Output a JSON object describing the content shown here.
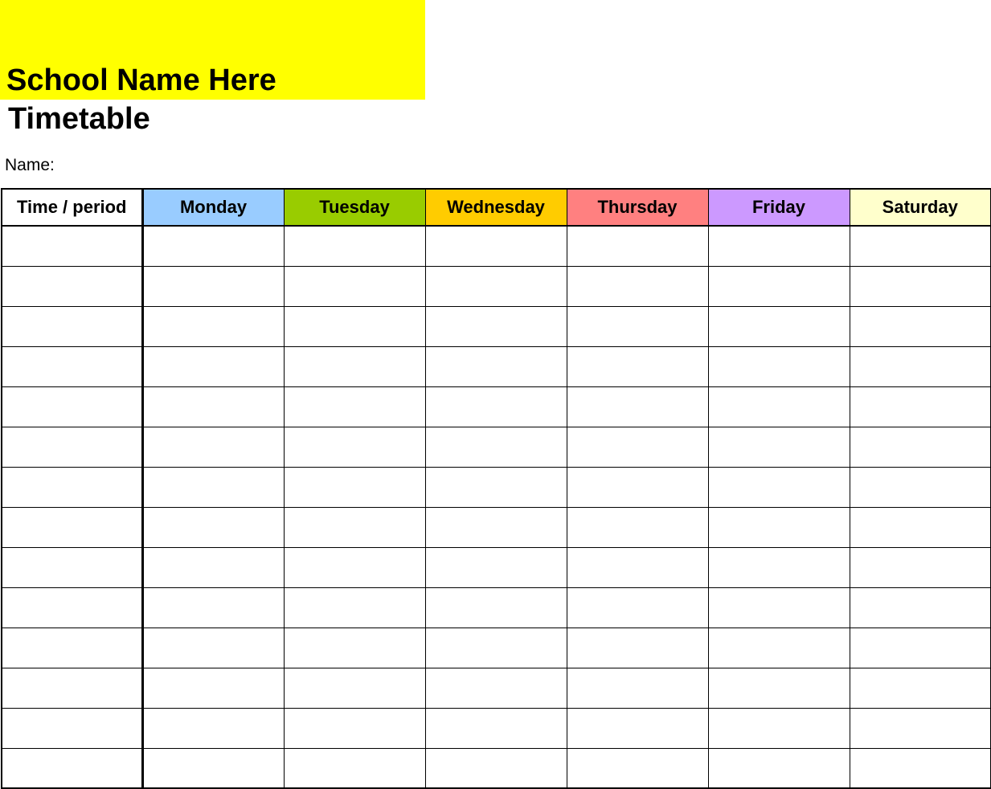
{
  "header": {
    "school_name": "School Name Here",
    "banner_color": "#ffff00",
    "title": "Timetable",
    "name_label": "Name:"
  },
  "timetable": {
    "first_column_header": "Time / period",
    "days": [
      {
        "label": "Monday",
        "color": "#99ccff"
      },
      {
        "label": "Tuesday",
        "color": "#99cc00"
      },
      {
        "label": "Wednesday",
        "color": "#ffcc00"
      },
      {
        "label": "Thursday",
        "color": "#ff8080"
      },
      {
        "label": "Friday",
        "color": "#cc99ff"
      },
      {
        "label": "Saturday",
        "color": "#ffffcc"
      }
    ],
    "row_count": 14,
    "cells": []
  }
}
